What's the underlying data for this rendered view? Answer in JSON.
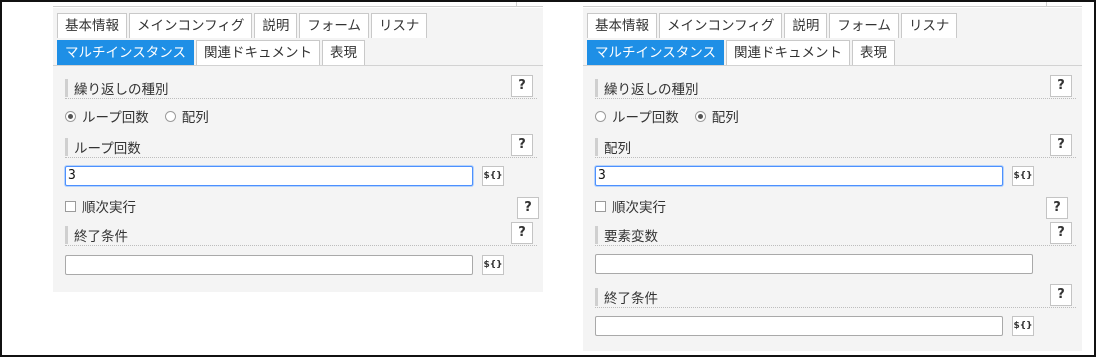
{
  "left": {
    "tabs_row1": [
      "基本情報",
      "メインコンフィグ",
      "説明",
      "フォーム",
      "リスナ"
    ],
    "tabs_row2": [
      "マルチインスタンス",
      "関連ドキュメント",
      "表現"
    ],
    "active_tab": "マルチインスタンス",
    "section_repeat_type": "繰り返しの種別",
    "radio_loop": "ループ回数",
    "radio_array": "配列",
    "selected_radio": "ループ回数",
    "section_loop_count": "ループ回数",
    "loop_count_value": "3",
    "var_button": "${}",
    "sequential_label": "順次実行",
    "section_end_condition": "終了条件",
    "end_condition_value": "",
    "help": "?"
  },
  "right": {
    "tabs_row1": [
      "基本情報",
      "メインコンフィグ",
      "説明",
      "フォーム",
      "リスナ"
    ],
    "tabs_row2": [
      "マルチインスタンス",
      "関連ドキュメント",
      "表現"
    ],
    "active_tab": "マルチインスタンス",
    "section_repeat_type": "繰り返しの種別",
    "radio_loop": "ループ回数",
    "radio_array": "配列",
    "selected_radio": "配列",
    "section_array": "配列",
    "array_value": "3",
    "var_button": "${}",
    "sequential_label": "順次実行",
    "section_element_var": "要素変数",
    "element_var_value": "",
    "section_end_condition": "終了条件",
    "end_condition_value": "",
    "help": "?"
  },
  "colors": {
    "active_tab": "#1e8fe6",
    "panel_bg": "#f4f4f4",
    "focus_border": "#4d90fe"
  }
}
